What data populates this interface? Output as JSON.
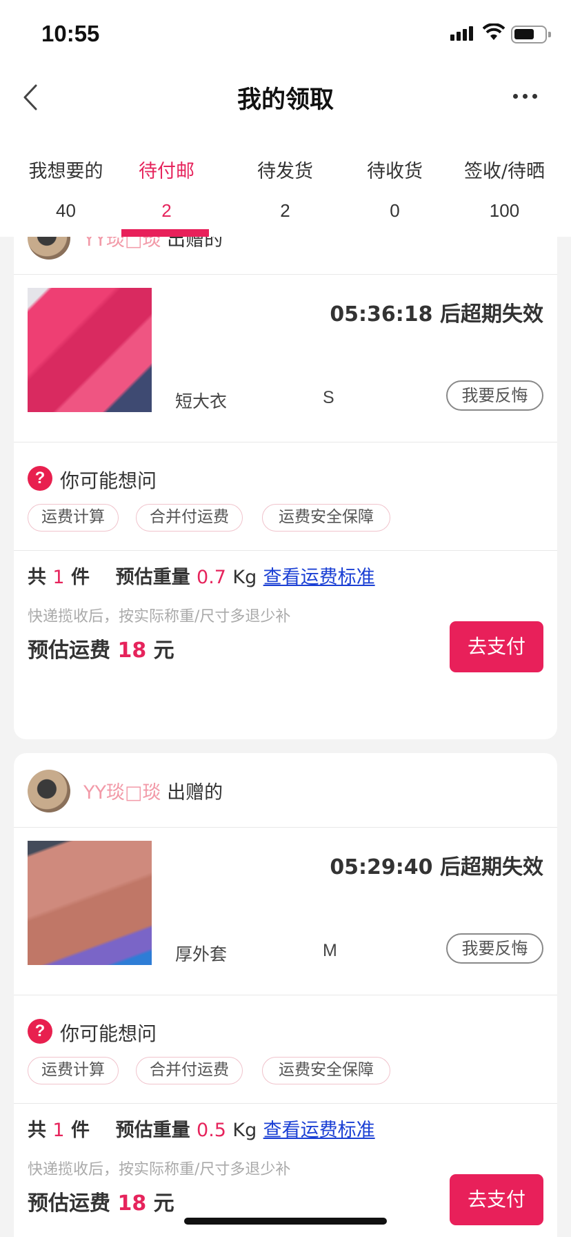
{
  "status_bar": {
    "time": "10:55"
  },
  "header": {
    "title": "我的领取"
  },
  "tabs": [
    {
      "label": "我想要的",
      "count": "40"
    },
    {
      "label": "待付邮",
      "count": "2"
    },
    {
      "label": "待发货",
      "count": "2"
    },
    {
      "label": "待收货",
      "count": "0"
    },
    {
      "label": "签收/待晒",
      "count": "100"
    }
  ],
  "active_tab": "待付邮",
  "orders": [
    {
      "giver_name": "YY琰□琰",
      "giver_suffix": "出赠的",
      "countdown": "05:36:18 后超期失效",
      "product_name": "短大衣",
      "size": "S",
      "regret_label": "我要反悔",
      "faq_title": "你可能想问",
      "faq_chips": [
        "运费计算",
        "合并付运费",
        "运费安全保障"
      ],
      "total_prefix": "共",
      "total_count": "1",
      "total_unit": "件",
      "weight_label": "预估重量",
      "weight_value": "0.7",
      "weight_unit": "Kg",
      "fee_standard_link": "查看运费标准",
      "note": "快递揽收后，按实际称重/尺寸多退少补",
      "fee_label": "预估运费",
      "fee_value": "18",
      "fee_unit": "元",
      "pay_label": "去支付"
    },
    {
      "giver_name": "YY琰□琰",
      "giver_suffix": "出赠的",
      "countdown": "05:29:40 后超期失效",
      "product_name": "厚外套",
      "size": "M",
      "regret_label": "我要反悔",
      "faq_title": "你可能想问",
      "faq_chips": [
        "运费计算",
        "合并付运费",
        "运费安全保障"
      ],
      "total_prefix": "共",
      "total_count": "1",
      "total_unit": "件",
      "weight_label": "预估重量",
      "weight_value": "0.5",
      "weight_unit": "Kg",
      "fee_standard_link": "查看运费标准",
      "note": "快递揽收后，按实际称重/尺寸多退少补",
      "fee_label": "预估运费",
      "fee_value": "18",
      "fee_unit": "元",
      "pay_label": "去支付"
    }
  ],
  "colors": {
    "accent": "#e8205a",
    "link": "#1a3fd4",
    "nickname": "#f29aa8"
  }
}
